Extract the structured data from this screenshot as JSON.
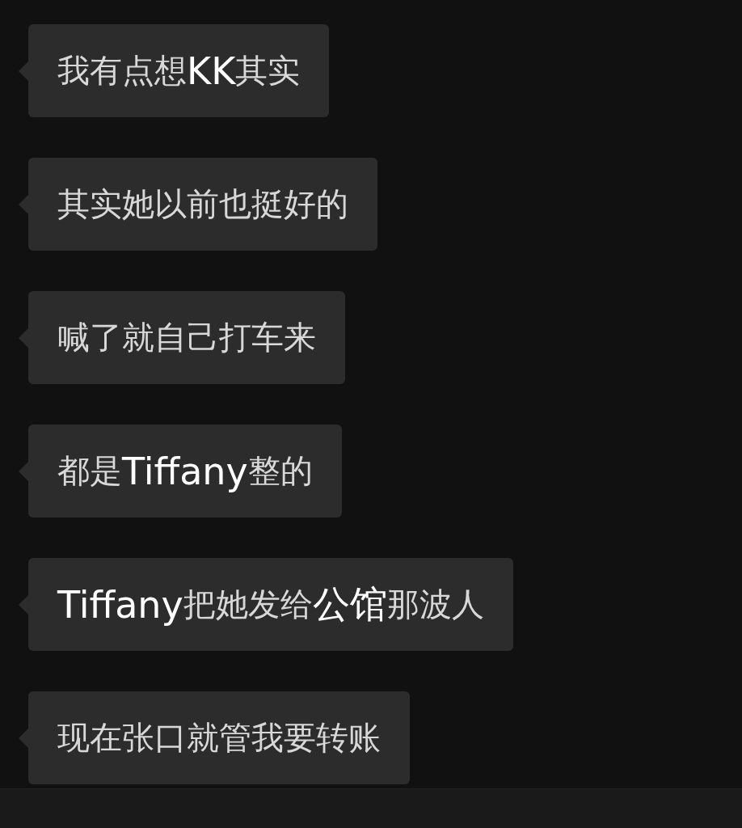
{
  "messages": [
    {
      "text": "我有点想**KK**其实"
    },
    {
      "text": "其实她以前也挺好的"
    },
    {
      "text": "喊了就自己打车来"
    },
    {
      "text": "都是**Tiffany**整的"
    },
    {
      "text": "**Tiffany**把她发给**公馆**那波人"
    },
    {
      "text": "现在张口就管我要转账"
    }
  ]
}
